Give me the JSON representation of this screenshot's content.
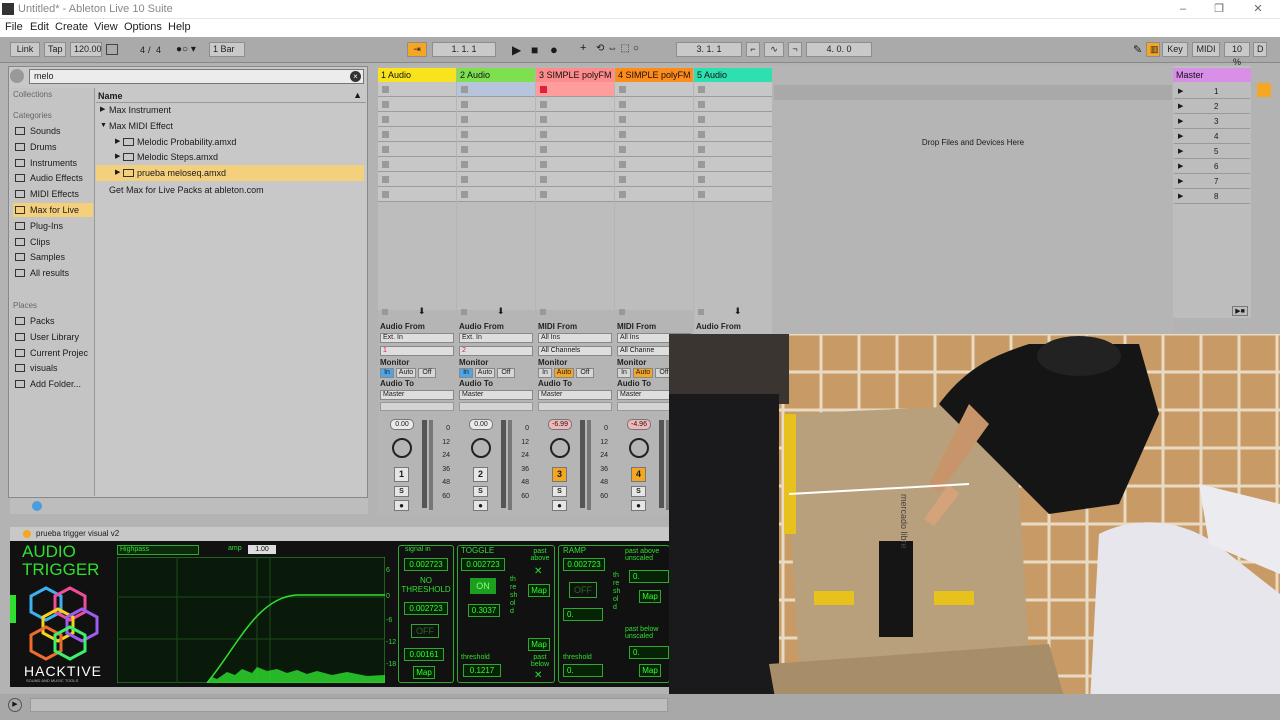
{
  "window": {
    "title": "Untitled* - Ableton Live 10 Suite",
    "min": "–",
    "max": "❐",
    "close": "✕"
  },
  "menu": [
    "File",
    "Edit",
    "Create",
    "View",
    "Options",
    "Help"
  ],
  "control_bar": {
    "link": "Link",
    "tap": "Tap",
    "tempo": "120.00",
    "time_sig_num": "4",
    "time_sig_sep": "/",
    "time_sig_den": "4",
    "quantize": "1 Bar",
    "position": "1.   1.   1",
    "loop_start": "3.   1.   1",
    "loop_length": "4.   0.   0",
    "key": "Key",
    "midi": "MIDI",
    "cpu": "10 %",
    "d": "D"
  },
  "browser": {
    "search_value": "melo",
    "collections_label": "Collections",
    "categories_label": "Categories",
    "categories": [
      "Sounds",
      "Drums",
      "Instruments",
      "Audio Effects",
      "MIDI Effects",
      "Max for Live",
      "Plug-Ins",
      "Clips",
      "Samples",
      "All results"
    ],
    "selected_category": 5,
    "places_label": "Places",
    "places": [
      "Packs",
      "User Library",
      "Current Projec",
      "visuals",
      "Add Folder..."
    ],
    "name_header": "Name",
    "items": [
      {
        "label": "Max Instrument",
        "arrow": "▶"
      },
      {
        "label": "Max MIDI Effect",
        "arrow": "▼"
      },
      {
        "label": "Melodic Probability.amxd",
        "arrow": "▶"
      },
      {
        "label": "Melodic Steps.amxd",
        "arrow": "▶"
      },
      {
        "label": "prueba meloseq.amxd",
        "arrow": "▶"
      }
    ],
    "get_max": "Get Max for Live Packs at ableton.com"
  },
  "tracks": [
    {
      "name": "1 Audio",
      "color": "#f8e31c",
      "in_label": "Audio From",
      "in1": "Ext. In",
      "in2": "1",
      "vol": "0.00",
      "num": "1",
      "num_active": false
    },
    {
      "name": "2 Audio",
      "color": "#7fe04f",
      "in_label": "Audio From",
      "in1": "Ext. In",
      "in2": "2",
      "vol": "0.00",
      "num": "2",
      "num_active": false
    },
    {
      "name": "3 SIMPLE polyFM",
      "color": "#ff8c8c",
      "in_label": "MIDI From",
      "in1": "All Ins",
      "in2": "All Channels",
      "vol": "-6.99",
      "num": "3",
      "num_active": true
    },
    {
      "name": "4 SIMPLE polyFM",
      "color": "#ff8c1a",
      "in_label": "MIDI From",
      "in1": "All Ins",
      "in2": "All Channe",
      "vol": "-4.96",
      "num": "4",
      "num_active": true
    },
    {
      "name": "5 Audio",
      "color": "#2de0b0",
      "in_label": "Audio From",
      "in1": "",
      "in2": "",
      "vol": "",
      "num": "",
      "num_active": false
    }
  ],
  "mixer_labels": {
    "monitor": "Monitor",
    "in": "In",
    "auto": "Auto",
    "off": "Off",
    "audio_to": "Audio To",
    "master": "Master",
    "solo": "S"
  },
  "db_scale": [
    "0",
    "12",
    "24",
    "36",
    "48",
    "60"
  ],
  "drop_text": "Drop Files and Devices Here",
  "master": {
    "name": "Master",
    "scenes": [
      "1",
      "2",
      "3",
      "4",
      "5",
      "6",
      "7",
      "8"
    ]
  },
  "device": {
    "title": "prueba trigger visual v2",
    "brand1": "AUDIO",
    "brand2": "TRIGGER",
    "brand3": "HACKTIVE",
    "brand_sub": "SOUND AND MUSIC TOOLS",
    "filter": "Highpass",
    "amp_label": "amp",
    "amp_value": "1.00",
    "signal_in": "signal in",
    "signal_val": "0.002723",
    "no_threshold": "NO THRESHOLD",
    "nt_val": "0.002723",
    "off": "OFF",
    "small_val": "0.00161",
    "map": "Map",
    "toggle": "TOGGLE",
    "toggle_val": "0.002723",
    "on": "ON",
    "toggle_val2": "0.3037",
    "threshold": "threshold",
    "thr_val": "0.1217",
    "past_above": "past above",
    "past_below": "past below",
    "ramp": "RAMP",
    "ramp_val": "0.002723",
    "ramp_zero": "0.",
    "past_above_unscaled": "past above unscaled",
    "past_below_unscaled": "past below unscaled",
    "vert_threshold": "threshold",
    "scale_ticks": [
      "6",
      "0",
      "-6",
      "-12",
      "-18"
    ]
  },
  "video": {
    "box_brand": "mercado libre"
  }
}
